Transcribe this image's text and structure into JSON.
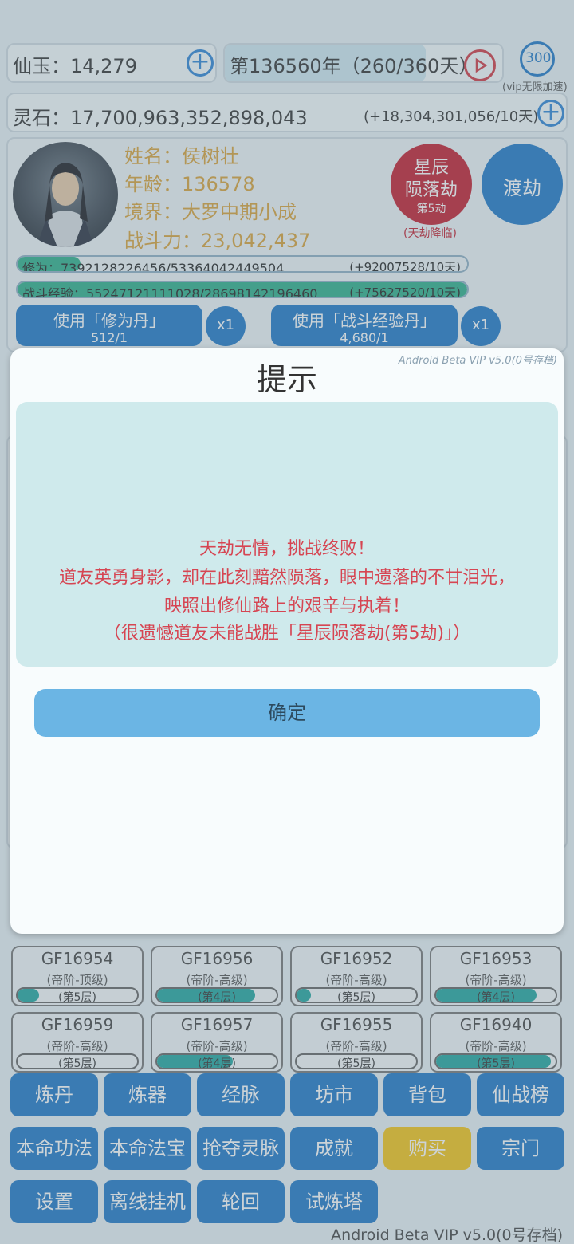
{
  "top": {
    "jade_label": "仙玉：14,279",
    "year_text": "第136560年（260/360天）",
    "speed_value": "300",
    "speed_caption": "(vip无限加速)",
    "stone_label": "灵石：17,700,963,352,898,043",
    "stone_rate": "(+18,304,301,056/10天)"
  },
  "profile": {
    "name": "姓名：侯树壮",
    "age": "年龄：136578",
    "realm": "境界：大罗中期小成",
    "power": "战斗力：23,042,437",
    "tribulation_title_1": "星辰",
    "tribulation_title_2": "陨落劫",
    "tribulation_stage": "第5劫",
    "tribulation_note": "(天劫降临)",
    "dujie_label": "渡劫"
  },
  "progress": {
    "cultivation_label": "修为：7392128226456/53364042449504",
    "cultivation_rate": "(+92007528/10天)",
    "cultivation_fraction": 0.14,
    "battle_label": "战斗经验：55247121111028/28698142196460",
    "battle_rate": "(+75627520/10天)",
    "battle_fraction": 1.0
  },
  "pills": {
    "use_cultivation_label": "使用「修为丹」",
    "use_cultivation_count": "512/1",
    "use_battle_label": "使用「战斗经验丹」",
    "use_battle_count": "4,680/1",
    "multiplier": "x1"
  },
  "cards": [
    {
      "name": "GF16954",
      "grade": "(帝阶-顶级)",
      "level": "(第5层)",
      "fill": 0.18
    },
    {
      "name": "GF16956",
      "grade": "(帝阶-高级)",
      "level": "(第4层)",
      "fill": 0.82
    },
    {
      "name": "GF16952",
      "grade": "(帝阶-高级)",
      "level": "(第5层)",
      "fill": 0.12
    },
    {
      "name": "GF16953",
      "grade": "(帝阶-高级)",
      "level": "(第4层)",
      "fill": 0.84
    },
    {
      "name": "GF16959",
      "grade": "(帝阶-高级)",
      "level": "(第5层)",
      "fill": 0.0
    },
    {
      "name": "GF16957",
      "grade": "(帝阶-高级)",
      "level": "(第4层)",
      "fill": 0.63
    },
    {
      "name": "GF16955",
      "grade": "(帝阶-高级)",
      "level": "(第5层)",
      "fill": 0.0
    },
    {
      "name": "GF16940",
      "grade": "(帝阶-高级)",
      "level": "(第5层)",
      "fill": 0.96
    }
  ],
  "nav": {
    "row1": [
      "炼丹",
      "炼器",
      "经脉",
      "坊市",
      "背包",
      "仙战榜"
    ],
    "row2": [
      "本命功法",
      "本命法宝",
      "抢夺灵脉",
      "成就",
      "购买",
      "宗门"
    ],
    "row3": [
      "设置",
      "离线挂机",
      "轮回",
      "试炼塔"
    ]
  },
  "footer_version": "Android Beta VIP v5.0(0号存档)",
  "modal": {
    "title": "提示",
    "version": "Android Beta VIP v5.0(0号存档)",
    "line1": "天劫无情，挑战终败！",
    "line2": "道友英勇身影，却在此刻黯然陨落，眼中遗落的不甘泪光，",
    "line3": "映照出修仙路上的艰辛与执着！",
    "line4": "（很遗憾道友未能战胜「星辰陨落劫(第5劫)」）",
    "confirm": "确定"
  },
  "colors": {
    "primary_blue": "#1f78c8",
    "tribulation_red": "#c41e2e",
    "message_red": "#d64552",
    "gold": "#f5c518",
    "profile_text": "#d9a23a"
  }
}
